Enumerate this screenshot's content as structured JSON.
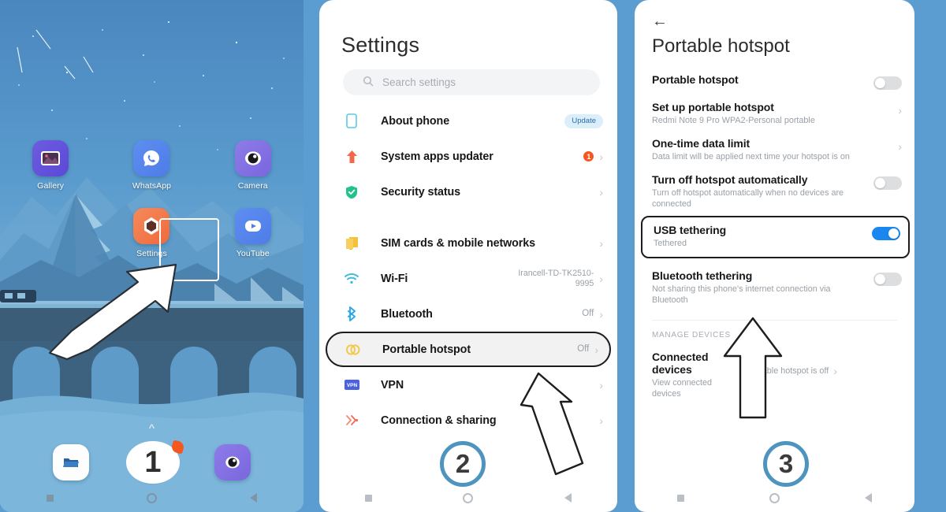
{
  "panel1": {
    "name": "android-home-screen",
    "apps_row1": [
      {
        "label": "Gallery",
        "icon": "gallery-icon"
      },
      {
        "label": "WhatsApp",
        "icon": "whatsapp-icon"
      },
      {
        "label": "Camera",
        "icon": "camera-icon"
      }
    ],
    "apps_row2": [
      {
        "label": "",
        "icon": ""
      },
      {
        "label": "Settings",
        "icon": "settings-icon"
      },
      {
        "label": "YouTube",
        "icon": "youtube-icon"
      }
    ],
    "dock": [
      {
        "icon": "files-icon"
      },
      {
        "icon": "dialer-icon"
      },
      {
        "icon": "camera-icon"
      }
    ],
    "nav": [
      "recents-icon",
      "home-icon",
      "back-icon"
    ],
    "step_marker": "1"
  },
  "panel2": {
    "title": "Settings",
    "search": {
      "placeholder": "Search settings",
      "icon": "search-icon"
    },
    "items": [
      {
        "label": "About phone",
        "value": "",
        "badge": "Update",
        "icon": "phone-outline-icon",
        "chevron": false,
        "highlight": false
      },
      {
        "label": "System apps updater",
        "value": "",
        "badge": "1",
        "icon": "up-arrow-icon",
        "chevron": true,
        "highlight": false
      },
      {
        "label": "Security status",
        "value": "",
        "badge": "",
        "icon": "shield-check-icon",
        "chevron": true,
        "highlight": false
      },
      {
        "label": "SIM cards & mobile networks",
        "value": "",
        "badge": "",
        "icon": "sim-card-icon",
        "chevron": true,
        "highlight": false
      },
      {
        "label": "Wi-Fi",
        "value": "Irancell-TD-TK2510-9995",
        "badge": "",
        "icon": "wifi-icon",
        "chevron": true,
        "highlight": false
      },
      {
        "label": "Bluetooth",
        "value": "Off",
        "badge": "",
        "icon": "bluetooth-icon",
        "chevron": true,
        "highlight": false
      },
      {
        "label": "Portable hotspot",
        "value": "Off",
        "badge": "",
        "icon": "hotspot-link-icon",
        "chevron": true,
        "highlight": true
      },
      {
        "label": "VPN",
        "value": "",
        "badge": "",
        "icon": "vpn-icon",
        "chevron": true,
        "highlight": false
      },
      {
        "label": "Connection & sharing",
        "value": "",
        "badge": "",
        "icon": "connection-sharing-icon",
        "chevron": true,
        "highlight": false
      }
    ],
    "nav": [
      "recents-icon",
      "home-icon",
      "back-icon"
    ],
    "step_marker": "2"
  },
  "panel3": {
    "back_icon": "back-arrow-icon",
    "title": "Portable hotspot",
    "rows": [
      {
        "title": "Portable hotspot",
        "subtitle": "",
        "control": "toggle",
        "toggle_on": false,
        "highlight": false
      },
      {
        "title": "Set up portable hotspot",
        "subtitle": "Redmi Note 9 Pro WPA2-Personal portable",
        "control": "chevron",
        "toggle_on": false,
        "highlight": false
      },
      {
        "title": "One-time data limit",
        "subtitle": "Data limit will be applied next time your hotspot is on",
        "control": "chevron",
        "toggle_on": false,
        "highlight": false
      },
      {
        "title": "Turn off hotspot automatically",
        "subtitle": "Turn off hotspot automatically when no devices are connected",
        "control": "toggle",
        "toggle_on": false,
        "highlight": false
      },
      {
        "title": "USB tethering",
        "subtitle": "Tethered",
        "control": "toggle",
        "toggle_on": true,
        "highlight": true
      },
      {
        "title": "Bluetooth tethering",
        "subtitle": "Not sharing this phone's internet connection via Bluetooth",
        "control": "toggle",
        "toggle_on": false,
        "highlight": false
      }
    ],
    "section_header": "MANAGE DEVICES",
    "connected": {
      "title": "Connected devices",
      "subtitle": "View connected devices",
      "value": "Portable hotspot is off"
    },
    "nav": [
      "recents-icon",
      "home-icon",
      "back-icon"
    ],
    "step_marker": "3"
  },
  "colors": {
    "accent_blue": "#1a87f0",
    "wallpaper_blue": "#5b9cd1",
    "step_ring": "#4d94bf",
    "badge_orange": "#f4581f",
    "update_badge_bg": "#dbeefb"
  }
}
